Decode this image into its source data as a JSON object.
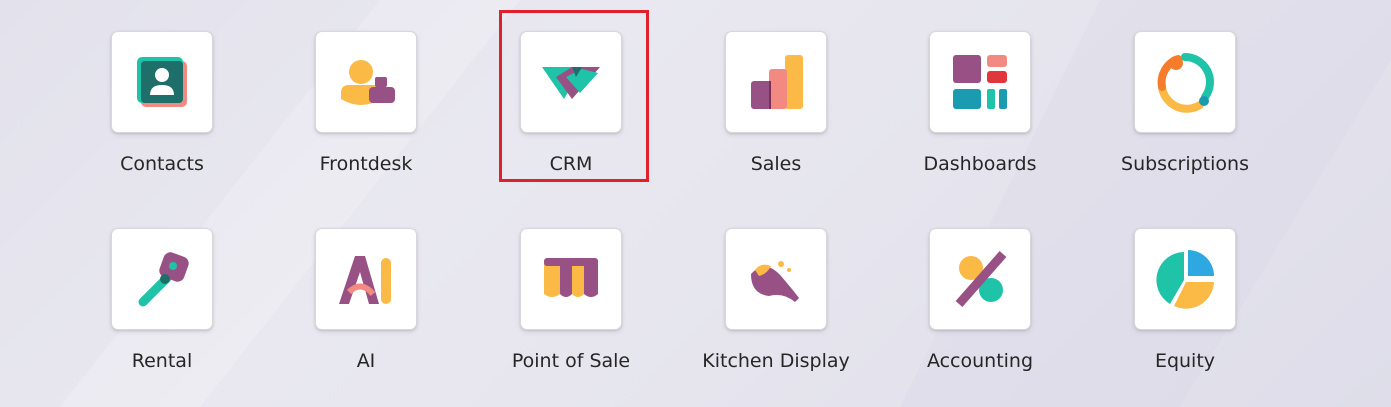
{
  "apps": [
    {
      "label": "Contacts",
      "icon": "contacts-icon"
    },
    {
      "label": "Frontdesk",
      "icon": "frontdesk-icon"
    },
    {
      "label": "CRM",
      "icon": "crm-handshake-icon"
    },
    {
      "label": "Sales",
      "icon": "sales-chart-icon"
    },
    {
      "label": "Dashboards",
      "icon": "dashboards-icon"
    },
    {
      "label": "Subscriptions",
      "icon": "subscriptions-cycle-icon"
    },
    {
      "label": "Rental",
      "icon": "rental-key-icon"
    },
    {
      "label": "AI",
      "icon": "ai-icon"
    },
    {
      "label": "Point of Sale",
      "icon": "point-of-sale-awning-icon"
    },
    {
      "label": "Kitchen Display",
      "icon": "kitchen-display-icon"
    },
    {
      "label": "Accounting",
      "icon": "accounting-percent-icon"
    },
    {
      "label": "Equity",
      "icon": "equity-pie-icon"
    }
  ],
  "highlighted_app": "CRM",
  "colors": {
    "teal": "#1fc3a8",
    "dark_teal": "#1e6e6a",
    "purple": "#985184",
    "orange": "#fbb945",
    "coral": "#f38a82",
    "blue": "#2ea8e0",
    "highlight": "#e0202a"
  }
}
